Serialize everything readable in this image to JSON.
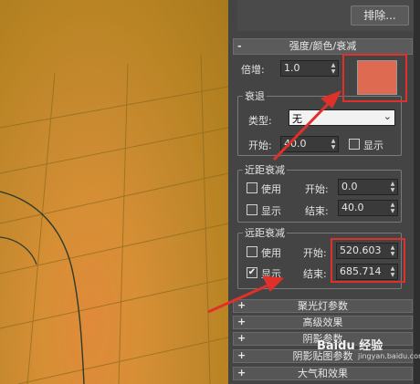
{
  "top": {
    "exclude_button": "排除..."
  },
  "rollout": {
    "title": "强度/颜色/衰减",
    "collapse_sign": "-",
    "multiplier_label": "倍增:",
    "multiplier_value": "1.0",
    "color_hex": "#df6a52"
  },
  "decay": {
    "title": "衰退",
    "type_label": "类型:",
    "type_value": "无",
    "start_label": "开始:",
    "start_value": "40.0",
    "show_label": "显示",
    "show_checked": false
  },
  "near_atten": {
    "title": "近距衰减",
    "use_label": "使用",
    "show_label": "显示",
    "start_label": "开始:",
    "start_value": "0.0",
    "end_label": "结束:",
    "end_value": "40.0"
  },
  "far_atten": {
    "title": "远距衰减",
    "use_label": "使用",
    "show_label": "显示",
    "show_mark": "✔",
    "start_label": "开始:",
    "start_value": "520.603",
    "end_label": "结束:",
    "end_value": "685.714"
  },
  "collapsed": [
    {
      "sign": "+",
      "label": "聚光灯参数"
    },
    {
      "sign": "+",
      "label": "高级效果"
    },
    {
      "sign": "+",
      "label": "阴影参数"
    },
    {
      "sign": "+",
      "label": "阴影贴图参数"
    },
    {
      "sign": "+",
      "label": "大气和效果"
    }
  ],
  "watermark": {
    "text": "Baidu 经验",
    "sub": "jingyan.baidu.com"
  },
  "colors": {
    "highlight": "#e0302a",
    "panel": "#444444",
    "viewport": "#c98a30"
  }
}
